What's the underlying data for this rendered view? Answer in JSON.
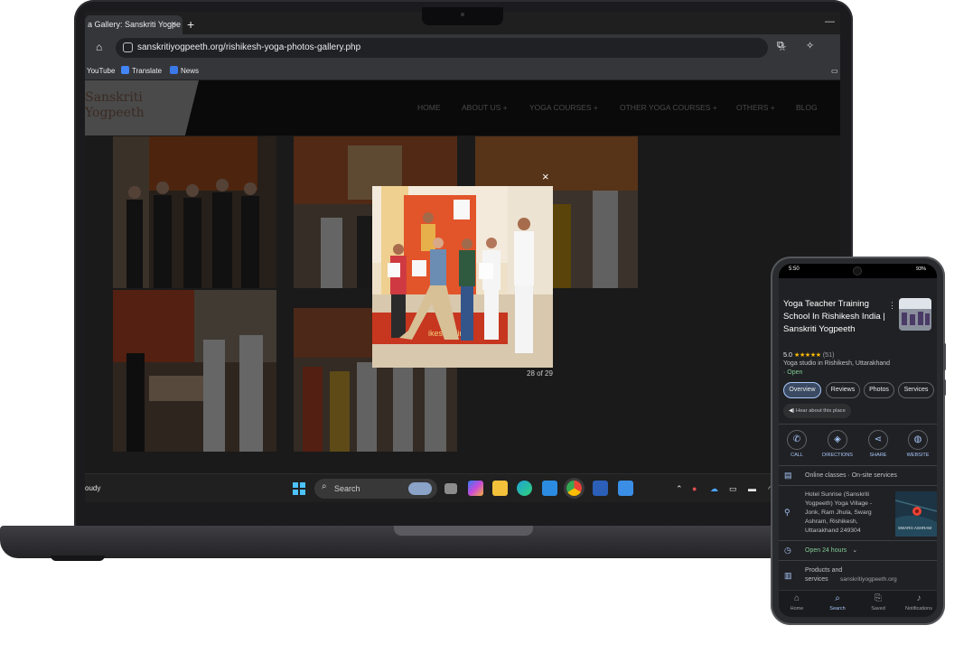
{
  "browser": {
    "tab_title": "a Gallery: Sanskriti Yogpe",
    "tab_close": "×",
    "new_tab": "+",
    "minimize": "—",
    "url": "sanskritiyogpeeth.org/rishikesh-yoga-photos-gallery.php",
    "bookmarks": [
      "YouTube",
      "Translate",
      "News"
    ]
  },
  "website": {
    "logo_line1": "Sanskriti",
    "logo_line2": "Yogpeeth",
    "nav": [
      "HOME",
      "ABOUT US +",
      "YOGA COURSES +",
      "OTHER YOGA COURSES +",
      "OTHERS +",
      "BLOG"
    ],
    "lightbox": {
      "close": "×",
      "counter": "28 of 29",
      "banner_text": "ikesh, Hin"
    }
  },
  "taskbar": {
    "weather": "oudy",
    "search_placeholder": "Search"
  },
  "phone": {
    "status_time": "5:50",
    "status_right": "93%",
    "place_title": "Yoga Teacher Training School In Rishikesh India | Sanskriti Yogpeeth",
    "rating": "5.0",
    "stars": "★★★★★",
    "review_count": "(51)",
    "category": "Yoga studio in Rishikesh, Uttarakhand",
    "open_status": "· Open",
    "chips": [
      "Overview",
      "Reviews",
      "Photos",
      "Services"
    ],
    "hear_about": "Hear about this place",
    "actions": [
      "CALL",
      "DIRECTIONS",
      "SHARE",
      "WEBSITE"
    ],
    "service_options": "Online classes · On-site services",
    "address": "Hotel Sunrise (Sanskriti Yogpeeth) Yoga Village - Jonk, Ram Jhula, Swarg Ashram, Rishikesh, Uttarakhand 249304",
    "map_label": "SWARG ASHRAM",
    "hours": "Open 24 hours",
    "products_label": "Products and services",
    "website_domain": "sanskritiyogpeeth.org",
    "bottom_nav": [
      "Home",
      "Search",
      "Saved",
      "Notifications"
    ]
  },
  "colors": {
    "accent_blue": "#a8c7fa",
    "open_green": "#81c995",
    "star_yellow": "#fbbc04",
    "site_header": "#0a0a0a"
  }
}
